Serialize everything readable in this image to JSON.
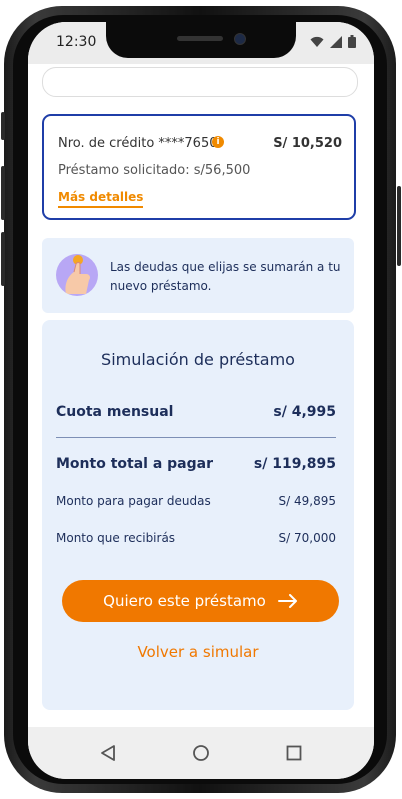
{
  "status_bar": {
    "time": "12:30"
  },
  "credit": {
    "label": "Nro. de crédito ****7650",
    "amount": "S/ 10,520",
    "requested": "Préstamo solicitado: s/56,500",
    "details_link": "Más detalles"
  },
  "info": {
    "text": "Las deudas que elijas se sumarán a tu nuevo préstamo."
  },
  "simulation": {
    "title": "Simulación de préstamo",
    "monthly_label": "Cuota mensual",
    "monthly_value": "s/ 4,995",
    "total_label": "Monto total a pagar",
    "total_value": "s/ 119,895",
    "debts_label": "Monto para pagar deudas",
    "debts_value": "S/ 49,895",
    "receive_label": "Monto que recibirás",
    "receive_value": "S/ 70,000",
    "cta_label": "Quiero este préstamo",
    "secondary_label": "Volver a simular"
  },
  "colors": {
    "accent": "#f07800",
    "primary": "#1d2e5a",
    "border": "#1f3ea8",
    "card_bg": "#e8f0fb"
  },
  "icons": [
    "wifi-icon",
    "signal-icon",
    "battery-icon",
    "info-icon",
    "arrow-right-icon",
    "back-icon",
    "home-icon",
    "recents-icon"
  ]
}
